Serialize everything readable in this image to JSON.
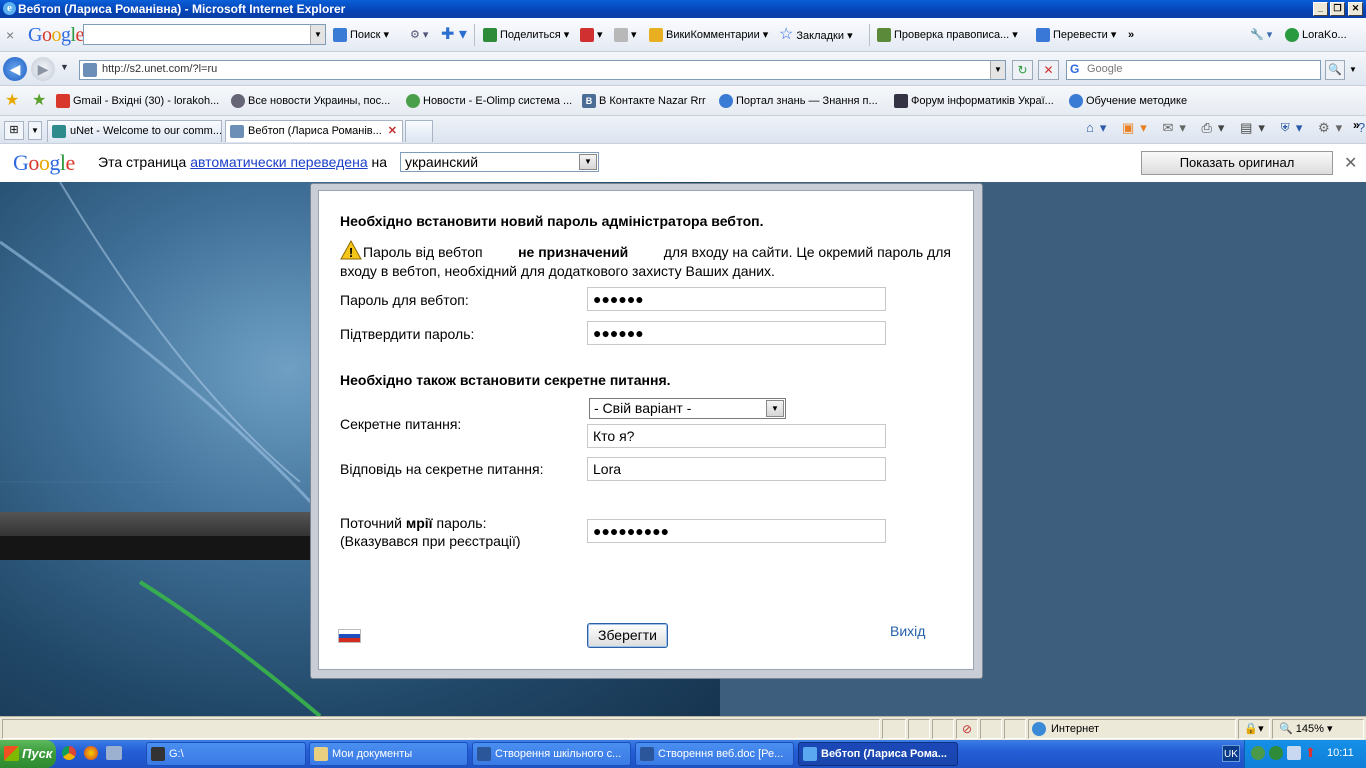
{
  "window": {
    "title": "Вебтоп (Лариса Романівна) - Microsoft Internet Explorer"
  },
  "google_toolbar": {
    "logo": "Google",
    "search_label": "Поиск",
    "share_label": "Поделиться",
    "wiki_label": "ВикиКомментарии",
    "bookmarks_label": "Закладки",
    "spell_label": "Проверка правописа...",
    "translate_label": "Перевести",
    "account_label": "LoraKo..."
  },
  "address_bar": {
    "url": "http://s2.unet.com/?l=ru",
    "search_placeholder": "Google"
  },
  "favorites": [
    {
      "label": "Gmail - Вхідні (30) - lorakoh..."
    },
    {
      "label": "Все новости Украины, пос..."
    },
    {
      "label": "Новости - E-Olimp система ..."
    },
    {
      "label": "В Контакте  Nazar Rrr"
    },
    {
      "label": "Портал знань — Знання п..."
    },
    {
      "label": "Форум інформатиків Украї..."
    },
    {
      "label": "Обучение методике"
    }
  ],
  "tabs": [
    {
      "label": "uNet - Welcome to our comm..."
    },
    {
      "label": "Вебтоп (Лариса Романів..."
    }
  ],
  "translate_bar": {
    "logo": "Google",
    "text_before": "Эта страница",
    "link": "автоматически переведена",
    "text_after": "на",
    "language": "украинский",
    "show_original": "Показать оригинал"
  },
  "form": {
    "heading1": "Необхідно встановити новий пароль адміністратора вебтоп.",
    "note_pre": "Пароль від вебтоп",
    "note_bold": "не призначений",
    "note_post": "для входу на сайти. Це окремий пароль для",
    "note_line2": "входу в вебтоп, необхідний для додаткового захисту Ваших даних.",
    "password_label": "Пароль для вебтоп:",
    "password_value": "●●●●●●",
    "confirm_label": "Підтвердити пароль:",
    "confirm_value": "●●●●●●",
    "heading2": "Необхідно також встановити секретне питання.",
    "secret_label": "Секретне питання:",
    "secret_select": "- Свій варіант -",
    "secret_value": "Кто я?",
    "answer_label": "Відповідь на секретне питання:",
    "answer_value": "Lora",
    "current_pre": "Поточний",
    "current_bold": "мрії",
    "current_post": "пароль:",
    "current_hint": "(Вказувався при реєстрації)",
    "current_value": "●●●●●●●●●",
    "save_button": "Зберегти",
    "exit_link": "Вихід"
  },
  "status_bar": {
    "zone": "Интернет",
    "zoom": "145%"
  },
  "taskbar": {
    "start": "Пуск",
    "drive": "G:\\",
    "items": [
      {
        "label": "Мои документы"
      },
      {
        "label": "Створення шкільного с..."
      },
      {
        "label": "Створення веб.doc [Ре..."
      },
      {
        "label": "Вебтоп (Лариса Рома..."
      }
    ],
    "lang": "UK",
    "clock": "10:11"
  }
}
